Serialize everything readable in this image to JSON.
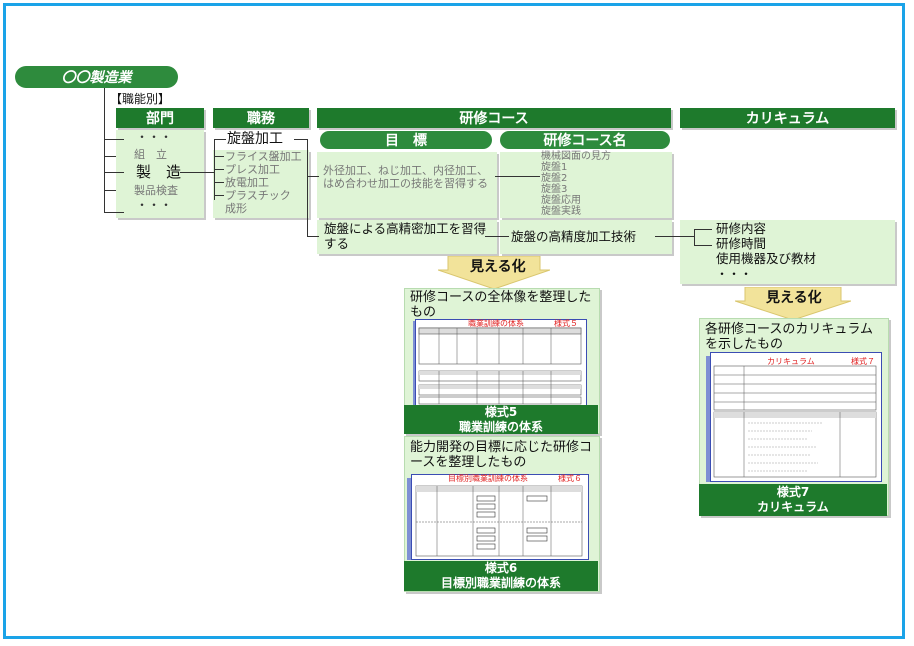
{
  "company": "〇〇製造業",
  "category_label": "【職能別】",
  "headers": {
    "department": "部門",
    "duties": "職務",
    "course": "研修コース",
    "curriculum": "カリキュラム",
    "goal": "目　標",
    "course_name": "研修コース名"
  },
  "departments": [
    "・・・",
    "組　立",
    "製　造",
    "製品検査",
    "・・・"
  ],
  "duties": [
    "旋盤加工",
    "フライス盤加工",
    "プレス加工",
    "放電加工",
    "プラスチック",
    "成形"
  ],
  "goal_text": "外径加工、ねじ加工、内径加工、はめ合わせ加工の技能を習得する",
  "course_names": [
    "機械図面の見方",
    "旋盤1",
    "旋盤2",
    "旋盤3",
    "旋盤応用",
    "旋盤実践"
  ],
  "selected_goal": "旋盤による高精密加工を習得する",
  "selected_course": "旋盤の高精度加工技術",
  "curriculum_items": [
    "研修内容",
    "研修時間",
    "使用機器及び教材",
    "・・・"
  ],
  "visualize_label": "見える化",
  "panels": {
    "p5": {
      "title": "研修コースの全体像を整理したもの",
      "doc_title": "職業訓練の体系",
      "doc_form": "様式５",
      "footer1": "様式5",
      "footer2": "職業訓練の体系"
    },
    "p6": {
      "title": "能力開発の目標に応じた研修コースを整理したもの",
      "doc_title": "目標別職業訓練の体系",
      "doc_form": "様式６",
      "footer1": "様式6",
      "footer2": "目標別職業訓練の体系"
    },
    "p7": {
      "title": "各研修コースのカリキュラムを示したもの",
      "doc_title": "カリキュラム",
      "doc_form": "様式７",
      "footer1": "様式7",
      "footer2": "カリキュラム"
    }
  },
  "colors": {
    "dark_green": "#1e7a2c",
    "light_green": "#dff4d6",
    "arrow_yellow": "#f2e39a",
    "border_blue": "#1aa3e8"
  }
}
